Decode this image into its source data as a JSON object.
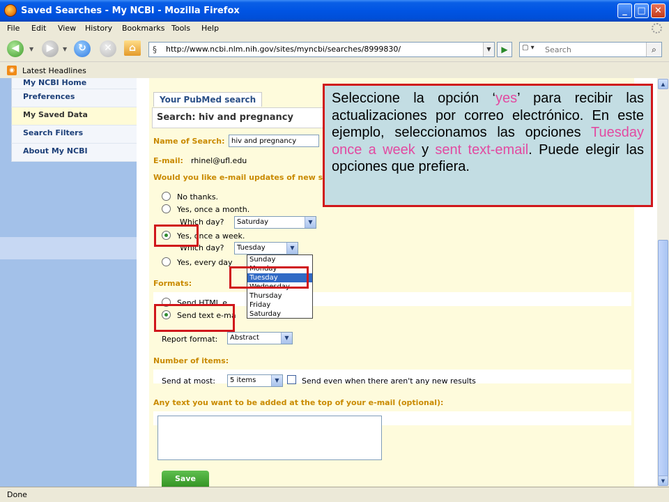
{
  "window": {
    "title": "Saved Searches - My NCBI - Mozilla Firefox"
  },
  "menu": {
    "items": [
      "File",
      "Edit",
      "View",
      "History",
      "Bookmarks",
      "Tools",
      "Help"
    ]
  },
  "nav": {
    "url": "http://www.ncbi.nlm.nih.gov/sites/myncbi/searches/8999830/",
    "search_placeholder": "Search"
  },
  "bookmarks": {
    "label": "Latest Headlines"
  },
  "sidebar": {
    "items": [
      "My NCBI Home",
      "Preferences",
      "My Saved Data",
      "Search Filters",
      "About My NCBI"
    ],
    "active_index": 2
  },
  "form": {
    "tab_title": "Your PubMed search",
    "heading": "Search: hiv and pregnancy",
    "name_label": "Name of Search:",
    "name_value": "hiv and pregnancy",
    "email_label": "E-mail:",
    "email_value": "rhinel@ufl.edu",
    "updates_question": "Would you like e-mail updates of new sea",
    "options": {
      "no": "No thanks.",
      "month": "Yes, once a month.",
      "which_day_1": "Which day?",
      "month_day": "Saturday",
      "week": "Yes, once a week.",
      "which_day_2": "Which day?",
      "week_day": "Tuesday",
      "everyday": "Yes, every day"
    },
    "day_list": [
      "Sunday",
      "Monday",
      "Tuesday",
      "Wednesday",
      "Thursday",
      "Friday",
      "Saturday"
    ],
    "day_selected_index": 2,
    "formats_label": "Formats:",
    "format_html": "Send HTML e",
    "format_text": "Send text e-ma",
    "report_format_label": "Report format:",
    "report_format_value": "Abstract",
    "number_label": "Number of items:",
    "send_at_most_label": "Send at most:",
    "send_at_most_value": "5 items",
    "send_even_label": "Send even when there aren't any new results",
    "extra_text_label": "Any text you want to be added at the top of your e-mail (optional):",
    "save_label": "Save"
  },
  "callout": {
    "part1": "Seleccione la opción ‘",
    "yes": "yes",
    "part2": "’ para recibir las actualizaciones por correo electrónico. En este ejemplo, seleccionamos las opciones ",
    "tuesday": "Tuesday once a week",
    "part3": " y ",
    "sent": "sent text-email",
    "part4": ". Puede elegir las opciones que prefiera."
  },
  "status": {
    "text": "Done"
  }
}
